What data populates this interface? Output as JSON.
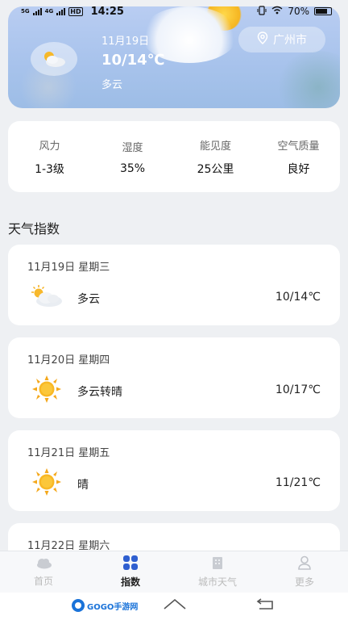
{
  "status_bar": {
    "network_1": "5G",
    "network_2": "4G",
    "hd": "HD",
    "time": "14:25",
    "battery": "70%"
  },
  "hero": {
    "date": "11月19日",
    "temp": "10/14℃",
    "condition": "多云",
    "city": "广州市",
    "icon": "partly-cloudy-icon"
  },
  "stats": [
    {
      "label": "风力",
      "value": "1-3级"
    },
    {
      "label": "湿度",
      "value": "35%"
    },
    {
      "label": "能见度",
      "value": "25公里"
    },
    {
      "label": "空气质量",
      "value": "良好"
    }
  ],
  "section_title": "天气指数",
  "days": [
    {
      "date": "11月19日 星期三",
      "condition": "多云",
      "temp": "10/14℃",
      "icon": "partly-cloudy-icon"
    },
    {
      "date": "11月20日 星期四",
      "condition": "多云转晴",
      "temp": "10/17℃",
      "icon": "sun-icon"
    },
    {
      "date": "11月21日 星期五",
      "condition": "晴",
      "temp": "11/21℃",
      "icon": "sun-icon"
    },
    {
      "date": "11月22日 星期六",
      "condition": "",
      "temp": "",
      "icon": ""
    }
  ],
  "nav": [
    {
      "label": "首页",
      "icon": "cloud-icon",
      "active": false
    },
    {
      "label": "指数",
      "icon": "grid-icon",
      "active": true
    },
    {
      "label": "城市天气",
      "icon": "building-icon",
      "active": false
    },
    {
      "label": "更多",
      "icon": "user-icon",
      "active": false
    }
  ],
  "watermark": "GOGO手游网",
  "colors": {
    "accent": "#2f5fd0",
    "hero_bg": "#a8c3ec",
    "sun": "#f5b521",
    "page_bg": "#eef0f3"
  }
}
